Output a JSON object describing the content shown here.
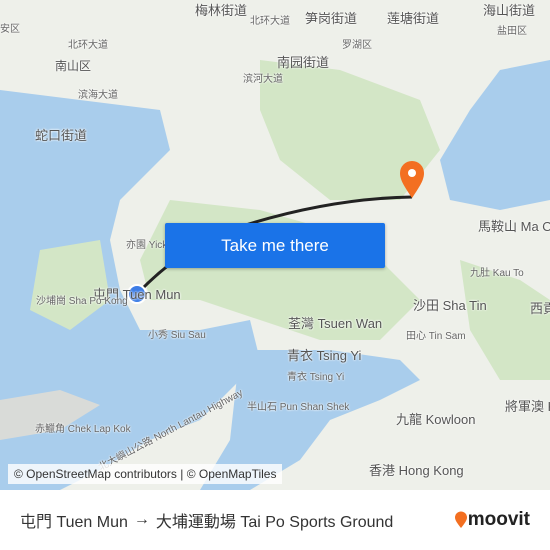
{
  "map": {
    "colors": {
      "water": "#a9cdec",
      "land": "#eef0ea",
      "green": "#d3e6c6",
      "route": "#222222",
      "origin": "#3d7de6",
      "destination": "#f36f21"
    },
    "labels": [
      {
        "text": "梅林街道",
        "cls": ""
      },
      {
        "text": "北环大道",
        "cls": "sm"
      },
      {
        "text": "笋岗街道",
        "cls": ""
      },
      {
        "text": "莲塘街道",
        "cls": ""
      },
      {
        "text": "海山街道",
        "cls": ""
      },
      {
        "text": "盐田区",
        "cls": "sm"
      },
      {
        "text": "安区",
        "cls": "sm"
      },
      {
        "text": "北环大道",
        "cls": "sm"
      },
      {
        "text": "南园街道",
        "cls": ""
      },
      {
        "text": "罗湖区",
        "cls": "sm"
      },
      {
        "text": "南山区",
        "cls": "md"
      },
      {
        "text": "滨河大道",
        "cls": "sm"
      },
      {
        "text": "滨海大道",
        "cls": "sm"
      },
      {
        "text": "蛇口街道",
        "cls": ""
      },
      {
        "text": "馬鞍山 Ma On Shan",
        "cls": ""
      },
      {
        "text": "亦園 Yick",
        "cls": "sm"
      },
      {
        "text": "屯門 Tuen Mun",
        "cls": ""
      },
      {
        "text": "沙埔崗 Sha Po Kong",
        "cls": "sm"
      },
      {
        "text": "九肚 Kau To",
        "cls": "sm"
      },
      {
        "text": "沙田 Sha Tin",
        "cls": ""
      },
      {
        "text": "西貢",
        "cls": ""
      },
      {
        "text": "小秀 Siu Sau",
        "cls": "sm"
      },
      {
        "text": "荃灣 Tsuen Wan",
        "cls": ""
      },
      {
        "text": "田心 Tin Sam",
        "cls": "sm"
      },
      {
        "text": "青衣 Tsing Yi",
        "cls": ""
      },
      {
        "text": "青衣 Tsing Yi",
        "cls": "sm"
      },
      {
        "text": "半山石 Pun Shan Shek",
        "cls": "sm"
      },
      {
        "text": "北大嶼山公路 North Lantau Highway",
        "cls": "sm"
      },
      {
        "text": "赤鱲角 Chek Lap Kok",
        "cls": "sm"
      },
      {
        "text": "九龍 Kowloon",
        "cls": ""
      },
      {
        "text": "將軍澳 Kwu",
        "cls": ""
      },
      {
        "text": "香港 Hong Kong",
        "cls": ""
      }
    ],
    "origin_icon": "origin-dot-icon",
    "destination_icon": "map-pin-icon"
  },
  "cta": {
    "label": "Take me there"
  },
  "attribution": "© OpenStreetMap contributors | © OpenMapTiles",
  "footer": {
    "origin": "屯門 Tuen Mun",
    "arrow": "→",
    "destination": "大埔運動場 Tai Po Sports Ground",
    "brand": "moovit"
  }
}
